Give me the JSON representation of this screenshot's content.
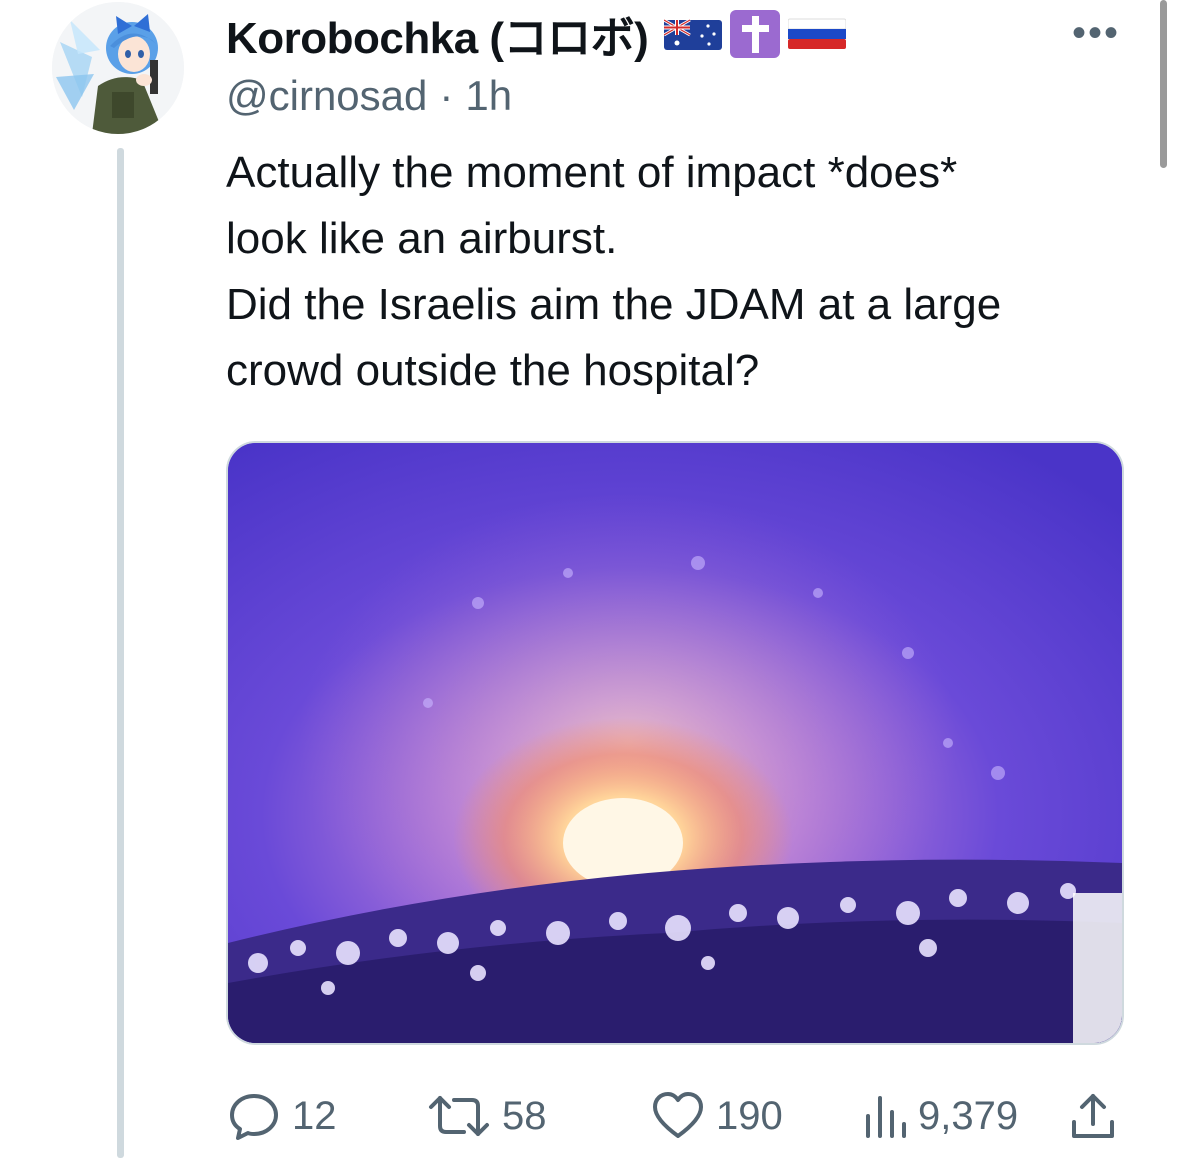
{
  "tweet": {
    "author": {
      "display_name": "Korobochka (コロボ)",
      "handle": "@cirnosad",
      "flags": [
        "australia-flag",
        "latin-cross-emoji",
        "russia-flag"
      ]
    },
    "separator": "·",
    "time": "1h",
    "text_lines": [
      "Actually the moment of impact *does*",
      "look like an airburst.",
      "Did the Israelis aim the JDAM at a large",
      "crowd outside the hospital?"
    ],
    "more_label": "•••",
    "actions": {
      "replies": "12",
      "reposts": "58",
      "likes": "190",
      "views": "9,379"
    }
  },
  "colors": {
    "text": "#0f1419",
    "muted": "#536471",
    "thread_line": "#cfd9de",
    "media_sky": "#5a3fd2",
    "explosion": "#ffd9a0"
  },
  "icons": {
    "reply": "speech-bubble-icon",
    "repost": "repost-arrows-icon",
    "like": "heart-icon",
    "views": "bar-chart-icon",
    "share": "share-upload-icon",
    "more": "more-dots-icon"
  }
}
